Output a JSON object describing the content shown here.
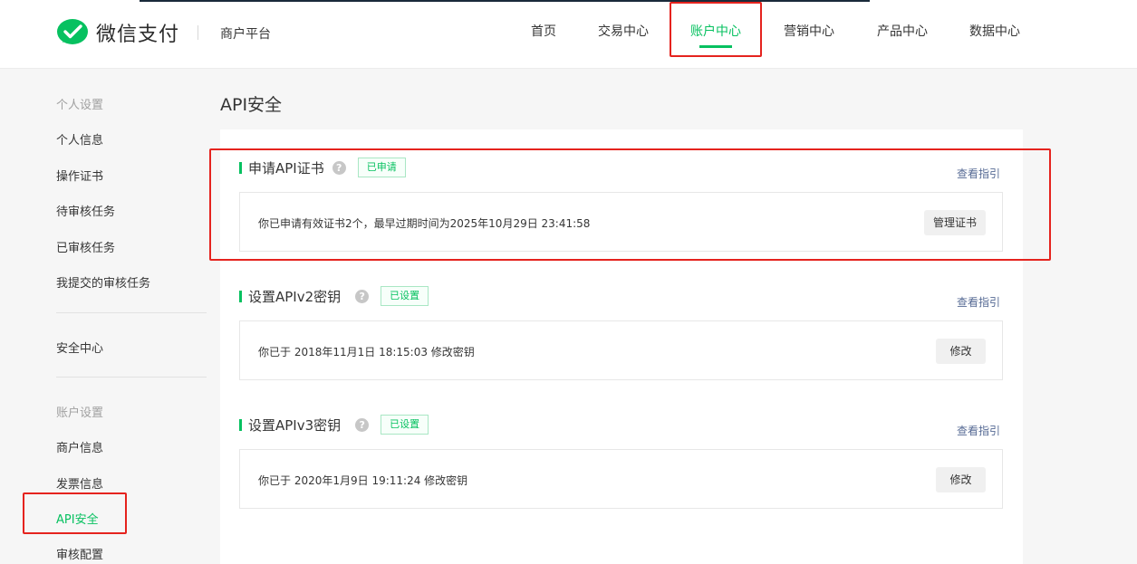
{
  "brand": {
    "logo_text": "微信支付",
    "platform": "商户平台"
  },
  "nav": {
    "items": [
      {
        "label": "首页"
      },
      {
        "label": "交易中心"
      },
      {
        "label": "账户中心"
      },
      {
        "label": "营销中心"
      },
      {
        "label": "产品中心"
      },
      {
        "label": "数据中心"
      }
    ],
    "active": "账户中心"
  },
  "sidebar": {
    "groups": [
      {
        "title": "个人设置",
        "items": [
          "个人信息",
          "操作证书",
          "待审核任务",
          "已审核任务",
          "我提交的审核任务"
        ]
      },
      {
        "title": "",
        "items": [
          "安全中心"
        ]
      },
      {
        "title": "账户设置",
        "items": [
          "商户信息",
          "发票信息",
          "API安全",
          "审核配置"
        ]
      }
    ],
    "active": "API安全"
  },
  "main": {
    "title": "API安全",
    "sections": [
      {
        "title": "申请API证书",
        "help_icon": "question-icon",
        "status": "已申请",
        "guide": "查看指引",
        "info": "你已申请有效证书2个，最早过期时间为2025年10月29日 23:41:58",
        "button": "管理证书"
      },
      {
        "title": "设置APIv2密钥",
        "help_icon": "question-icon",
        "status": "已设置",
        "guide": "查看指引",
        "info": "你已于 2018年11月1日 18:15:03 修改密钥",
        "button": "修改"
      },
      {
        "title": "设置APIv3密钥",
        "help_icon": "question-icon",
        "status": "已设置",
        "guide": "查看指引",
        "info": "你已于 2020年1月9日 19:11:24 修改密钥",
        "button": "修改"
      }
    ]
  },
  "colors": {
    "accent": "#07c160",
    "link": "#576b95",
    "highlight": "#e5231e"
  }
}
